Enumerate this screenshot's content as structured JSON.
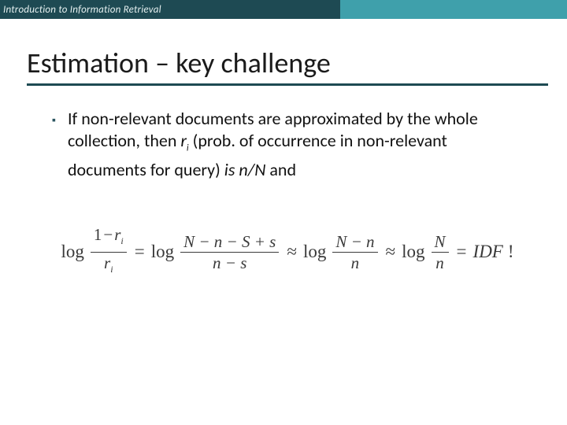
{
  "header": {
    "course": "Introduction to Information Retrieval"
  },
  "title": "Estimation – key challenge",
  "bullet": {
    "text_pre": "If non-relevant documents are approximated by the whole collection, then ",
    "var": "r",
    "sub": "i",
    "text_mid": " (prob. of occurrence in non-relevant documents for query) ",
    "is_word": "is ",
    "ratio": "n/N",
    "text_post": " and"
  },
  "formula": {
    "log1": "log",
    "f1_num_a": "1",
    "f1_num_op": "−",
    "f1_num_b": "r",
    "f1_num_sub": "i",
    "f1_den": "r",
    "f1_den_sub": "i",
    "eq1": "=",
    "log2": "log",
    "f2_num": "N − n − S + s",
    "f2_den": "n − s",
    "approx1": "≈",
    "log3": "log",
    "f3_num": "N − n",
    "f3_den": "n",
    "approx2": "≈",
    "log4": "log",
    "f4_num": "N",
    "f4_den": "n",
    "eq2": "=",
    "idf": "IDF",
    "bang": "!"
  }
}
